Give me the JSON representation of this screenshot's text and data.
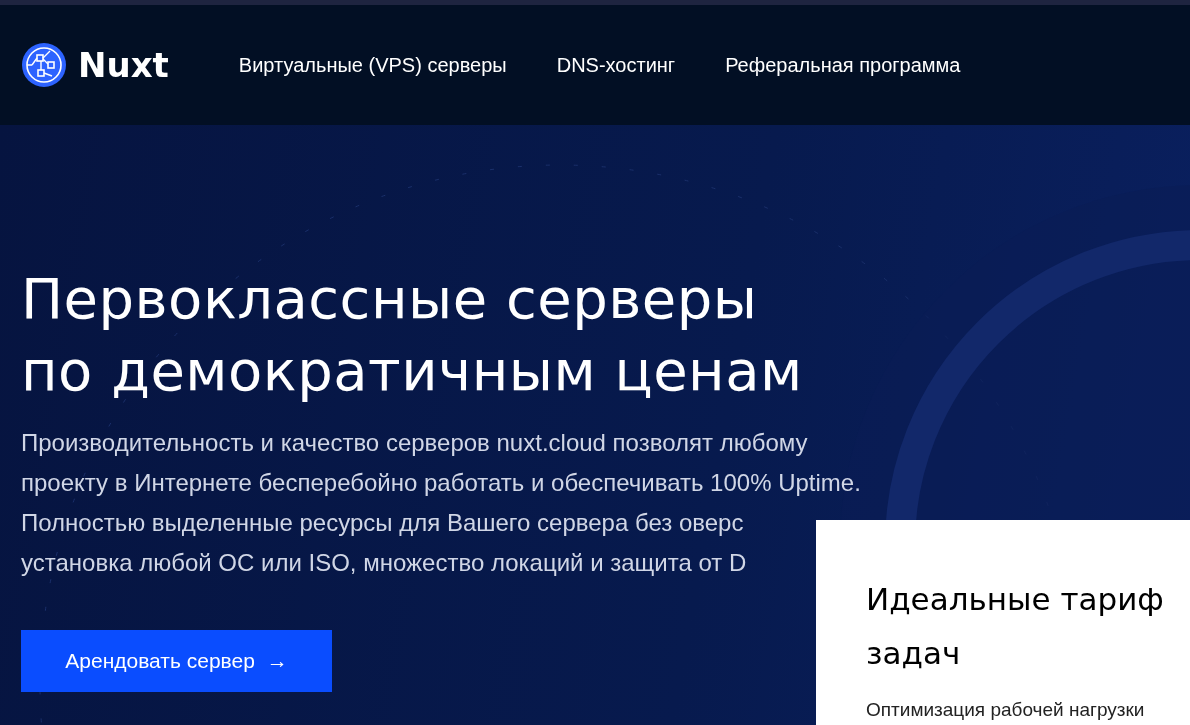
{
  "header": {
    "brand": "Nuxt",
    "nav": [
      {
        "label": "Виртуальные (VPS) серверы"
      },
      {
        "label": "DNS-хостинг"
      },
      {
        "label": "Реферальная программа"
      }
    ]
  },
  "hero": {
    "title_lines": [
      "Первоклассные серверы",
      "по демократичным ценам"
    ],
    "description_lines": [
      "Производительность и качество серверов nuxt.cloud позволят любому",
      "проекту в Интернете бесперебойно работать и обеспечивать 100% Uptime.",
      "Полностью выделенные ресурсы для Вашего сервера без оверс",
      "установка любой ОС или ISO, множество локаций и защита от D"
    ],
    "button": {
      "label": "Арендовать сервер",
      "icon": "→"
    }
  },
  "card": {
    "title_lines": [
      "Идеальные тариф",
      "задач"
    ],
    "text": "Оптимизация рабочей нагрузки"
  }
}
